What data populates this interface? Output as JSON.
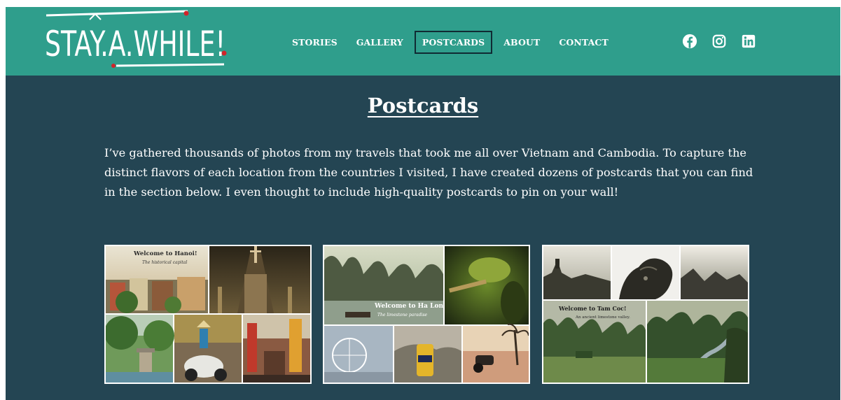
{
  "site": {
    "logo_text": "STAY.A.WHILE!"
  },
  "nav": {
    "items": [
      {
        "label": "STORIES",
        "active": false
      },
      {
        "label": "GALLERY",
        "active": false
      },
      {
        "label": "POSTCARDS",
        "active": true
      },
      {
        "label": "ABOUT",
        "active": false
      },
      {
        "label": "CONTACT",
        "active": false
      }
    ]
  },
  "social": [
    {
      "icon": "facebook-icon"
    },
    {
      "icon": "instagram-icon"
    },
    {
      "icon": "linkedin-icon"
    }
  ],
  "page": {
    "title": "Postcards",
    "intro": "I’ve gathered thousands of photos from my travels that took me all over Vietnam and Cambodia. To capture the distinct flavors of each location from the countries I visited, I have created dozens of postcards that you can find in the section below. I even thought to include high-quality postcards to pin on your wall!"
  },
  "postcards": [
    {
      "caption": "Welcome to Hanoi!",
      "subcaption": "The historical capital"
    },
    {
      "caption": "Welcome to Ha Long!",
      "subcaption": "The limestone paradise"
    },
    {
      "caption": "Welcome to Tam Coc!",
      "subcaption": "An ancient limestone valley."
    }
  ],
  "colors": {
    "header_bg": "#2f9e8c",
    "page_bg": "#244553",
    "nav_active_border": "#102a33",
    "logo_accent": "#d0242a"
  }
}
